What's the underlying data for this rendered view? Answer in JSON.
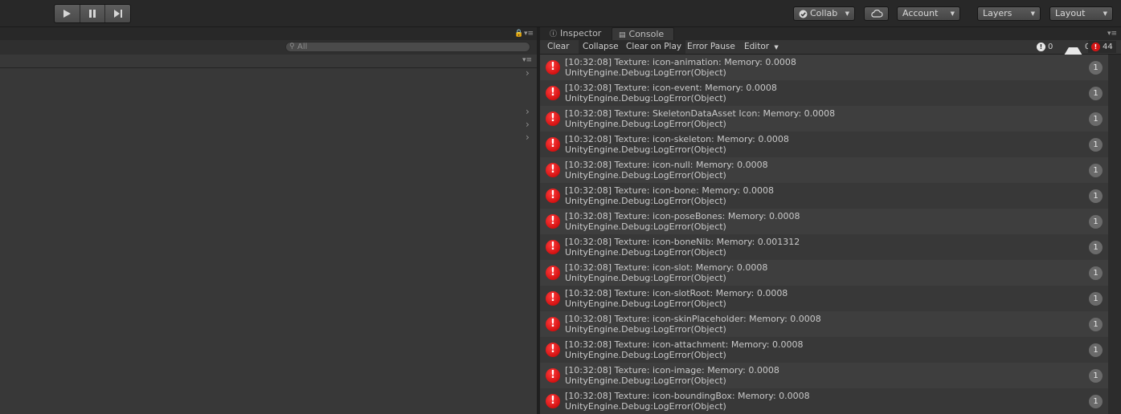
{
  "toolbar": {
    "play_icon": "play-icon",
    "pause_icon": "pause-icon",
    "step_icon": "step-icon",
    "collab_label": "Collab",
    "account_label": "Account",
    "layers_label": "Layers",
    "layout_label": "Layout"
  },
  "left_panel": {
    "search_placeholder": "All"
  },
  "tabs": [
    {
      "label": "Inspector",
      "icon": "info-icon"
    },
    {
      "label": "Console",
      "icon": "console-icon"
    }
  ],
  "console_toolbar": {
    "clear": "Clear",
    "collapse": "Collapse",
    "clear_on_play": "Clear on Play",
    "error_pause": "Error Pause",
    "editor": "Editor",
    "info_count": "0",
    "warning_count": "0",
    "error_count": "44"
  },
  "logs": [
    {
      "line1": "[10:32:08] Texture: icon-animation: Memory: 0.0008",
      "line2": "UnityEngine.Debug:LogError(Object)",
      "count": "1"
    },
    {
      "line1": "[10:32:08] Texture: icon-event: Memory: 0.0008",
      "line2": "UnityEngine.Debug:LogError(Object)",
      "count": "1"
    },
    {
      "line1": "[10:32:08] Texture: SkeletonDataAsset Icon: Memory: 0.0008",
      "line2": "UnityEngine.Debug:LogError(Object)",
      "count": "1"
    },
    {
      "line1": "[10:32:08] Texture: icon-skeleton: Memory: 0.0008",
      "line2": "UnityEngine.Debug:LogError(Object)",
      "count": "1"
    },
    {
      "line1": "[10:32:08] Texture: icon-null: Memory: 0.0008",
      "line2": "UnityEngine.Debug:LogError(Object)",
      "count": "1"
    },
    {
      "line1": "[10:32:08] Texture: icon-bone: Memory: 0.0008",
      "line2": "UnityEngine.Debug:LogError(Object)",
      "count": "1"
    },
    {
      "line1": "[10:32:08] Texture: icon-poseBones: Memory: 0.0008",
      "line2": "UnityEngine.Debug:LogError(Object)",
      "count": "1"
    },
    {
      "line1": "[10:32:08] Texture: icon-boneNib: Memory: 0.001312",
      "line2": "UnityEngine.Debug:LogError(Object)",
      "count": "1"
    },
    {
      "line1": "[10:32:08] Texture: icon-slot: Memory: 0.0008",
      "line2": "UnityEngine.Debug:LogError(Object)",
      "count": "1"
    },
    {
      "line1": "[10:32:08] Texture: icon-slotRoot: Memory: 0.0008",
      "line2": "UnityEngine.Debug:LogError(Object)",
      "count": "1"
    },
    {
      "line1": "[10:32:08] Texture: icon-skinPlaceholder: Memory: 0.0008",
      "line2": "UnityEngine.Debug:LogError(Object)",
      "count": "1"
    },
    {
      "line1": "[10:32:08] Texture: icon-attachment: Memory: 0.0008",
      "line2": "UnityEngine.Debug:LogError(Object)",
      "count": "1"
    },
    {
      "line1": "[10:32:08] Texture: icon-image: Memory: 0.0008",
      "line2": "UnityEngine.Debug:LogError(Object)",
      "count": "1"
    },
    {
      "line1": "[10:32:08] Texture: icon-boundingBox: Memory: 0.0008",
      "line2": "UnityEngine.Debug:LogError(Object)",
      "count": "1"
    }
  ]
}
